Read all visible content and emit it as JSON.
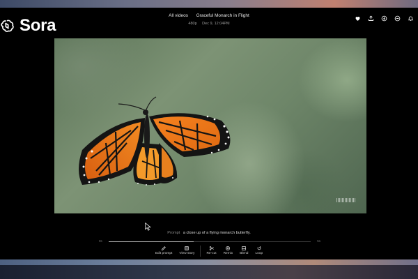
{
  "app": {
    "name": "Sora",
    "breadcrumb": "All videos",
    "video_title": "Graceful Monarch in Flight",
    "resolution": "480p",
    "date": "Dec 9, 12:04PM"
  },
  "header_icons": [
    "heart-icon",
    "share-icon",
    "download-icon",
    "more-icon",
    "notification-icon"
  ],
  "prompt": {
    "label": "Prompt",
    "text": "a close up of a flying monarch butterfly."
  },
  "timeline": {
    "start": "0s",
    "end": "5s",
    "progress": 0.42
  },
  "controls": {
    "edit_prompt": "Edit prompt",
    "view_story": "View story",
    "recut": "Re-cut",
    "remix": "Remix",
    "blend": "Blend",
    "loop": "Loop"
  },
  "colors": {
    "accent_orange": "#f07a1c",
    "wing_black": "#141414",
    "background": "#000000"
  }
}
